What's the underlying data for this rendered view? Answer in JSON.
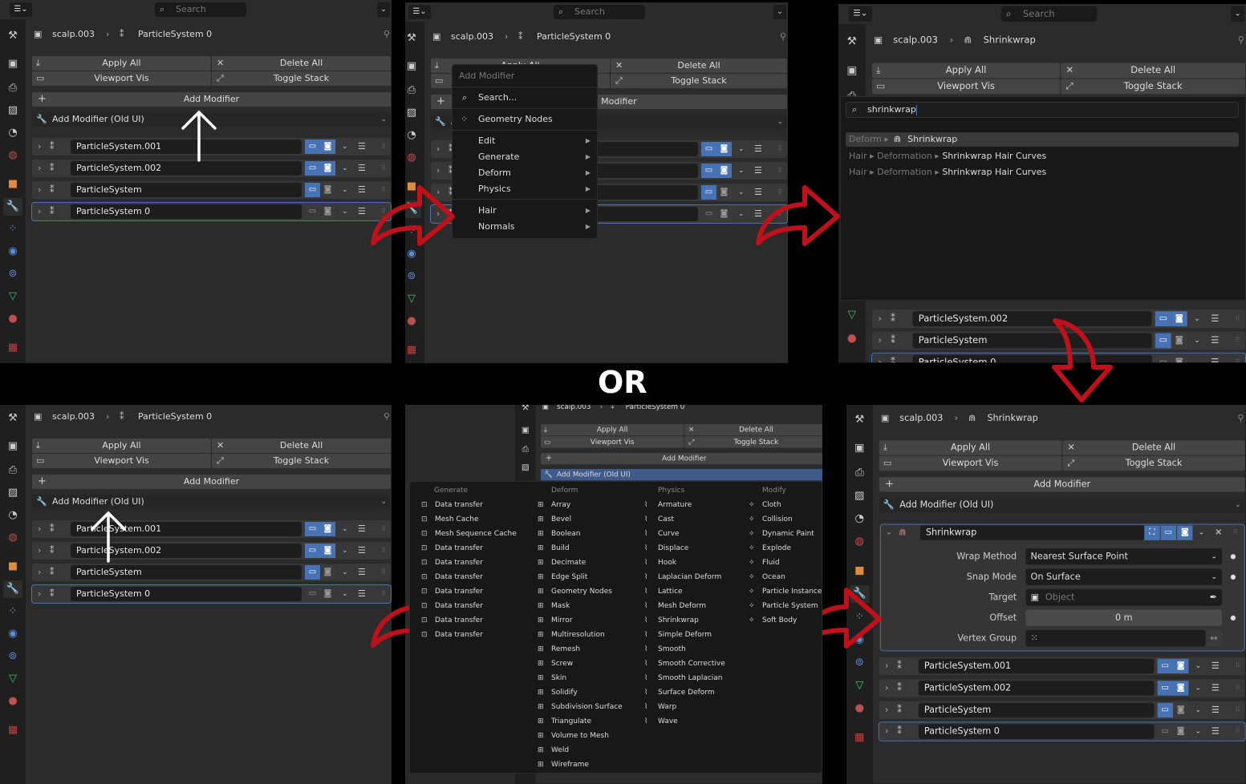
{
  "common": {
    "search_placeholder": "Search",
    "object_name": "scalp.003",
    "apply_all": "Apply All",
    "delete_all": "Delete All",
    "viewport_vis": "Viewport Vis",
    "toggle_stack": "Toggle Stack",
    "add_modifier": "Add Modifier",
    "add_modifier_old": "Add Modifier (Old UI)",
    "crumb_particle": "ParticleSystem 0",
    "crumb_shrinkwrap": "Shrinkwrap"
  },
  "modifiers": [
    {
      "name": "ParticleSystem.001",
      "viewport": true,
      "render": true
    },
    {
      "name": "ParticleSystem.002",
      "viewport": true,
      "render": true
    },
    {
      "name": "ParticleSystem",
      "viewport": true,
      "render": false
    },
    {
      "name": "ParticleSystem 0",
      "viewport": false,
      "render": false
    }
  ],
  "add_menu": {
    "title": "Add Modifier",
    "search": "Search...",
    "geometry_nodes": "Geometry Nodes",
    "submenus": [
      "Edit",
      "Generate",
      "Deform",
      "Physics"
    ],
    "submenus2": [
      "Hair",
      "Normals"
    ]
  },
  "search_popup": {
    "query": "shrinkwrap",
    "results": [
      {
        "path": "Deform ▸",
        "name": "Shrinkwrap",
        "highlighted": true
      },
      {
        "path": "Hair ▸ Deformation ▸",
        "name": "Shrinkwrap Hair Curves",
        "highlighted": false
      },
      {
        "path": "Hair ▸ Deformation ▸",
        "name": "Shrinkwrap Hair Curves",
        "highlighted": false
      }
    ]
  },
  "separator_text": "OR",
  "old_menu": {
    "columns": [
      {
        "header": "Generate",
        "items": [
          "Data transfer",
          "Mesh Cache",
          "Mesh Sequence Cache",
          "Data transfer",
          "Data transfer",
          "Data transfer",
          "Data transfer",
          "Data transfer",
          "Data transfer",
          "Data transfer"
        ]
      },
      {
        "header": "Deform",
        "items": [
          "Array",
          "Bevel",
          "Boolean",
          "Build",
          "Decimate",
          "Edge Split",
          "Geometry Nodes",
          "Mask",
          "Mirror",
          "Multiresolution",
          "Remesh",
          "Screw",
          "Skin",
          "Solidify",
          "Subdivision Surface",
          "Triangulate",
          "Volume to Mesh",
          "Weld",
          "Wireframe"
        ]
      },
      {
        "header": "Physics",
        "items": [
          "Armature",
          "Cast",
          "Curve",
          "Displace",
          "Hook",
          "Laplacian Deform",
          "Lattice",
          "Mesh Deform",
          "Shrinkwrap",
          "Simple Deform",
          "Smooth",
          "Smooth Corrective",
          "Smooth Laplacian",
          "Surface Deform",
          "Warp",
          "Wave"
        ]
      },
      {
        "header": "Modify",
        "items": [
          "Cloth",
          "Collision",
          "Dynamic Paint",
          "Explode",
          "Fluid",
          "Ocean",
          "Particle Instance",
          "Particle System",
          "Soft Body"
        ]
      }
    ]
  },
  "shrinkwrap_panel": {
    "name": "Shrinkwrap",
    "wrap_method_label": "Wrap Method",
    "wrap_method": "Nearest Surface Point",
    "snap_mode_label": "Snap Mode",
    "snap_mode": "On Surface",
    "target_label": "Target",
    "target_placeholder": "Object",
    "offset_label": "Offset",
    "offset": "0 m",
    "vertex_group_label": "Vertex Group",
    "vertex_group": ""
  },
  "colors": {
    "accent": "#4772b3",
    "annotation_red": "#c0101a",
    "annotation_white": "#ffffff",
    "menu_bg": "#181818"
  }
}
